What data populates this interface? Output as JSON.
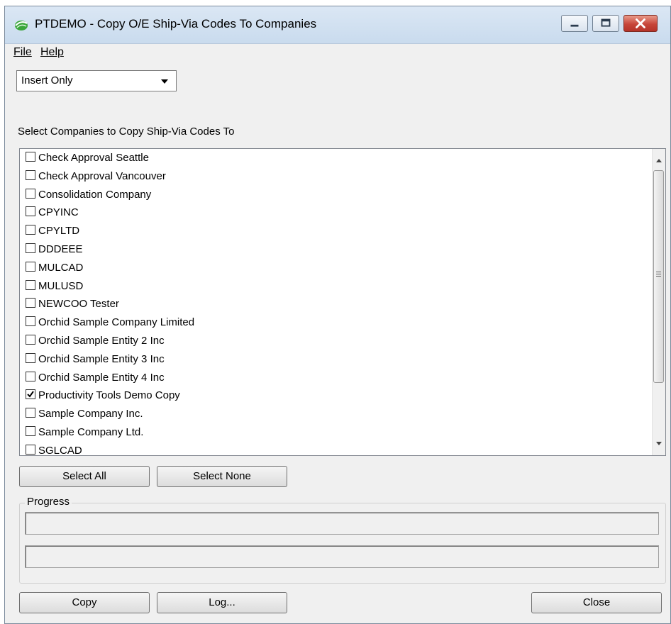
{
  "window": {
    "title": "PTDEMO - Copy O/E Ship-Via Codes To Companies",
    "app_icon": "sage-leaf-icon"
  },
  "menu": {
    "file_label": "File",
    "help_label": "Help"
  },
  "mode_select": {
    "value": "Insert Only"
  },
  "companies_section": {
    "label": "Select Companies to Copy Ship-Via Codes To",
    "items": [
      {
        "label": "Check Approval Seattle",
        "checked": false
      },
      {
        "label": "Check Approval Vancouver",
        "checked": false
      },
      {
        "label": "Consolidation Company",
        "checked": false
      },
      {
        "label": "CPYINC",
        "checked": false
      },
      {
        "label": "CPYLTD",
        "checked": false
      },
      {
        "label": "DDDEEE",
        "checked": false
      },
      {
        "label": "MULCAD",
        "checked": false
      },
      {
        "label": "MULUSD",
        "checked": false
      },
      {
        "label": "NEWCOO Tester",
        "checked": false
      },
      {
        "label": "Orchid Sample Company Limited",
        "checked": false
      },
      {
        "label": "Orchid Sample Entity 2 Inc",
        "checked": false
      },
      {
        "label": "Orchid Sample Entity 3 Inc",
        "checked": false
      },
      {
        "label": "Orchid Sample Entity 4 Inc",
        "checked": false
      },
      {
        "label": "Productivity Tools Demo Copy",
        "checked": true
      },
      {
        "label": "Sample Company Inc.",
        "checked": false
      },
      {
        "label": "Sample Company Ltd.",
        "checked": false
      },
      {
        "label": "SGLCAD",
        "checked": false
      }
    ]
  },
  "buttons": {
    "select_all": "Select All",
    "select_none": "Select None",
    "copy": "Copy",
    "log": "Log...",
    "close": "Close"
  },
  "progress": {
    "label": "Progress",
    "bar1_value": 0,
    "bar2_value": 0
  },
  "colors": {
    "window_bg": "#f0f0f0",
    "titlebar": "#c9dbee",
    "close_button": "#c7463a"
  }
}
